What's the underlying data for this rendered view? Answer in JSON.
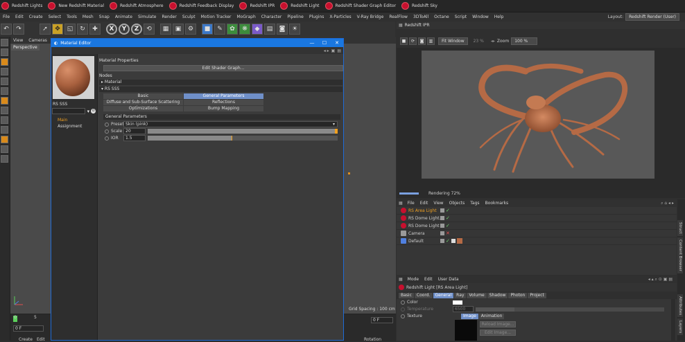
{
  "plugin_bar": [
    "Redshift Lights",
    "New Redshift Material",
    "Redshift Atmosphere",
    "Redshift Feedback Display",
    "Redshift IPR",
    "Redshift Light",
    "Redshift Shader Graph Editor",
    "Redshift Sky"
  ],
  "menu": [
    "File",
    "Edit",
    "Create",
    "Select",
    "Tools",
    "Mesh",
    "Snap",
    "Animate",
    "Simulate",
    "Render",
    "Sculpt",
    "Motion Tracker",
    "MoGraph",
    "Character",
    "Pipeline",
    "Plugins",
    "X-Particles",
    "V-Ray Bridge",
    "RealFlow",
    "3DToAll",
    "Octane",
    "Script",
    "Window",
    "Help"
  ],
  "layout": {
    "label": "Layout:",
    "value": "Redshift Render (User)"
  },
  "toolbar": {
    "x": "X",
    "y": "Y",
    "z": "Z"
  },
  "viewport": {
    "menu": [
      "View",
      "Cameras"
    ],
    "label": "Perspective",
    "grid_spacing": "Grid Spacing : 100 cm"
  },
  "timeline": {
    "marks": [
      "0",
      "5",
      "10"
    ],
    "frame": "0 F",
    "frame2": "0 F",
    "create": "Create",
    "edit": "Edit",
    "rotation": "Rotation"
  },
  "material_editor": {
    "title": "Material Editor",
    "material_name": "RS SSS",
    "left_items": [
      "Main",
      "Assignment"
    ],
    "properties_header": "Material Properties",
    "edit_button": "Edit Shader Graph...",
    "nodes_header": "Nodes",
    "material_node": "▸ Material",
    "rs_sss_node": "▾ RS SSS",
    "tabs": [
      {
        "label": "Basic",
        "active": false
      },
      {
        "label": "General Parameters",
        "active": true
      },
      {
        "label": "Diffuse and Sub-Surface Scattering Layers",
        "active": false
      },
      {
        "label": "Reflections",
        "active": false
      },
      {
        "label": "Optimizations",
        "active": false
      },
      {
        "label": "Bump Mapping",
        "active": false
      }
    ],
    "group_title": "General Parameters",
    "preset": {
      "label": "Preset",
      "value": "Skin (pink)"
    },
    "scale": {
      "label": "Scale",
      "value": "20",
      "fraction": 1.0
    },
    "ior": {
      "label": "IOR",
      "value": "1.5",
      "fraction": 0.44
    }
  },
  "ipr": {
    "title": "Redshift IPR",
    "fit": "Fit Window",
    "pct": "23 %",
    "zoom_label": "Zoom",
    "zoom_value": "100 %",
    "status": "Rendering 72%",
    "progress": 0.72
  },
  "objects": {
    "menu": [
      "File",
      "Edit",
      "View",
      "Objects",
      "Tags",
      "Bookmarks"
    ],
    "items": [
      {
        "name": "RS Area Light",
        "color": "#f0a020"
      },
      {
        "name": "RS Dome Light.1",
        "color": "#dddddd"
      },
      {
        "name": "RS Dome Light",
        "color": "#dddddd"
      },
      {
        "name": "Camera",
        "color": "#dddddd"
      },
      {
        "name": "Default",
        "color": "#dddddd"
      }
    ]
  },
  "right_tabs": [
    "Struct",
    "Content Browser",
    "Attributes",
    "Layers"
  ],
  "attributes": {
    "menu": [
      "Mode",
      "Edit",
      "User Data"
    ],
    "title": "Redshift Light [RS Area Light]",
    "tabs": [
      {
        "label": "Basic",
        "active": false
      },
      {
        "label": "Coord.",
        "active": false
      },
      {
        "label": "General",
        "active": true
      },
      {
        "label": "Ray",
        "active": false
      },
      {
        "label": "Volume",
        "active": false
      },
      {
        "label": "Shadow",
        "active": false
      },
      {
        "label": "Photon",
        "active": false
      },
      {
        "label": "Project",
        "active": false
      }
    ],
    "color_label": "Color",
    "temperature_label": "Temperature",
    "temperature_value": "6500",
    "texture_label": "Texture",
    "texture_tabs": [
      "Image",
      "Animation"
    ],
    "reload_button": "Reload Image...",
    "edit_button": "Edit Image..."
  }
}
